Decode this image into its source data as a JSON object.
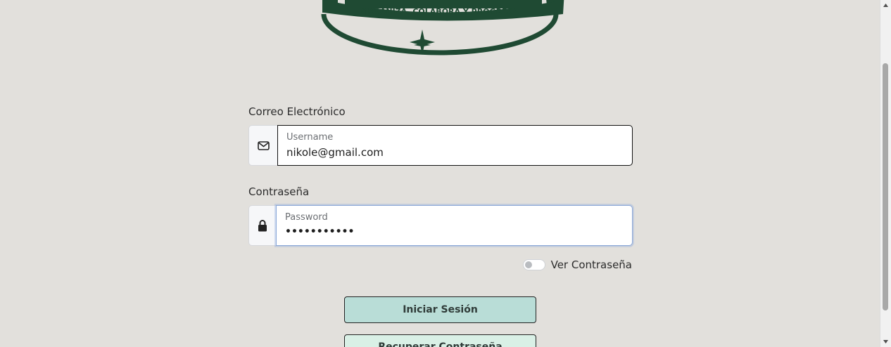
{
  "logo": {
    "tagline": "ORGANIZA, COLABORA Y PROGRESA",
    "icon": "taskmaster-logo"
  },
  "form": {
    "email": {
      "label": "Correo Electrónico",
      "placeholder": "Username",
      "value": "nikole@gmail.com",
      "icon": "envelope-icon"
    },
    "password": {
      "label": "Contraseña",
      "placeholder": "Password",
      "value": "•••••••••••",
      "icon": "lock-icon"
    },
    "show_password": {
      "label": "Ver Contraseña",
      "checked": false
    }
  },
  "buttons": {
    "login": "Iniciar Sesión",
    "recover": "Recuperar Contraseña"
  },
  "colors": {
    "background": "#e2e0dc",
    "logo_green": "#1f4a33",
    "login_button": "#b9ddd7",
    "recover_button": "#d9f0e6"
  }
}
